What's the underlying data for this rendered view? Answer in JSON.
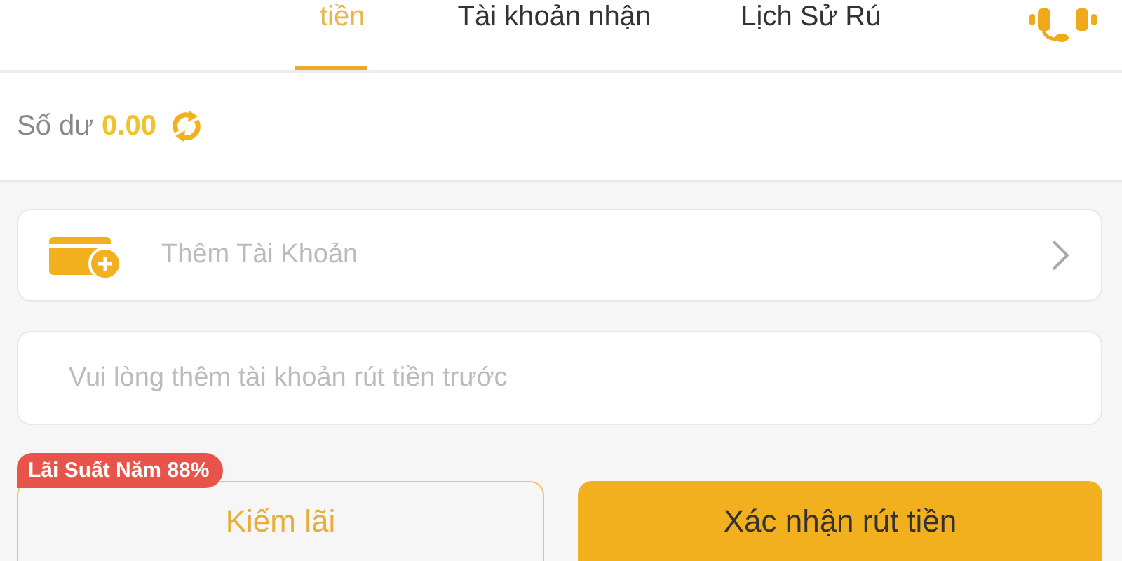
{
  "tabs": [
    {
      "label": "tiền",
      "selected": true
    },
    {
      "label": "Tài khoản nhận",
      "selected": false
    },
    {
      "label": "Lịch Sử Rú",
      "selected": false
    }
  ],
  "balance": {
    "label": "Số dư",
    "amount": "0.00"
  },
  "add_account": {
    "label": "Thêm Tài Khoản"
  },
  "note_field": {
    "placeholder": "Vui lòng thêm tài khoản rút tiền trước"
  },
  "interest_badge": "Lãi Suất Năm 88%",
  "buttons": [
    {
      "label": "Kiếm lãi",
      "kind": "outline"
    },
    {
      "label": "Xác nhận rút tiền",
      "kind": "filled"
    }
  ]
}
